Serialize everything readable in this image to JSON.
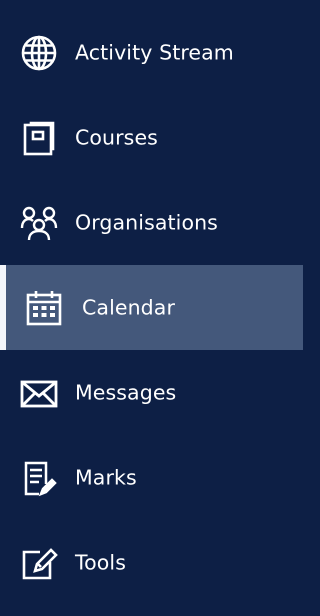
{
  "colors": {
    "background": "#0d1f45",
    "active_background": "#44587b",
    "active_indicator": "#f3f6fb",
    "text": "#ffffff"
  },
  "sidebar": {
    "items": [
      {
        "label": "Activity Stream",
        "icon": "globe-icon",
        "active": false
      },
      {
        "label": "Courses",
        "icon": "course-book-icon",
        "active": false
      },
      {
        "label": "Organisations",
        "icon": "people-group-icon",
        "active": false
      },
      {
        "label": "Calendar",
        "icon": "calendar-icon",
        "active": true
      },
      {
        "label": "Messages",
        "icon": "envelope-icon",
        "active": false
      },
      {
        "label": "Marks",
        "icon": "document-pencil-icon",
        "active": false
      },
      {
        "label": "Tools",
        "icon": "edit-box-icon",
        "active": false
      }
    ]
  }
}
